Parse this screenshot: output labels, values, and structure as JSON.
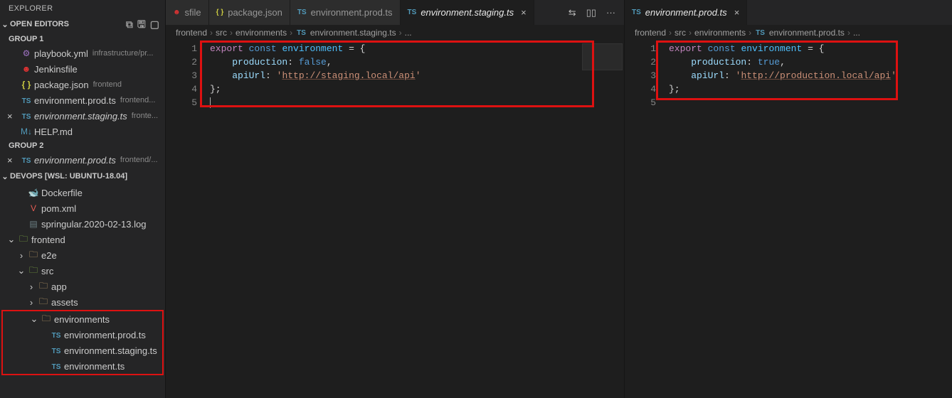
{
  "explorer": {
    "title": "EXPLORER",
    "openEditorsLabel": "OPEN EDITORS",
    "group1": "GROUP 1",
    "group2": "GROUP 2",
    "workspaceLabel": "DEVOPS [WSL: UBUNTU-18.04]",
    "openGroup1": [
      {
        "icon": "yml",
        "name": "playbook.yml",
        "dim": "infrastructure/pr..."
      },
      {
        "icon": "jenkins",
        "name": "Jenkinsfile",
        "dim": ""
      },
      {
        "icon": "json",
        "name": "package.json",
        "dim": "frontend"
      },
      {
        "icon": "ts",
        "name": "environment.prod.ts",
        "dim": "frontend..."
      },
      {
        "icon": "ts",
        "name": "environment.staging.ts",
        "dim": "fronte...",
        "close": true,
        "italic": true
      },
      {
        "icon": "md",
        "name": "HELP.md",
        "dim": ""
      }
    ],
    "openGroup2": [
      {
        "icon": "ts",
        "name": "environment.prod.ts",
        "dim": "frontend/...",
        "close": true,
        "italic": true
      }
    ],
    "tree": [
      {
        "indent": 1,
        "arrow": "",
        "icon": "docker",
        "label": "Dockerfile"
      },
      {
        "indent": 1,
        "arrow": "",
        "icon": "xml",
        "label": "pom.xml"
      },
      {
        "indent": 1,
        "arrow": "",
        "icon": "log",
        "label": "springular.2020-02-13.log"
      },
      {
        "indent": 0,
        "arrow": "v",
        "icon": "folder-g",
        "label": "frontend"
      },
      {
        "indent": 1,
        "arrow": ">",
        "icon": "folder",
        "label": "e2e"
      },
      {
        "indent": 1,
        "arrow": "v",
        "icon": "folder-g",
        "label": "src"
      },
      {
        "indent": 2,
        "arrow": ">",
        "icon": "folder",
        "label": "app"
      },
      {
        "indent": 2,
        "arrow": ">",
        "icon": "folder",
        "label": "assets"
      }
    ],
    "envFolder": {
      "indent": 2,
      "arrow": "v",
      "icon": "folder",
      "label": "environments"
    },
    "envFiles": [
      {
        "indent": 3,
        "icon": "ts",
        "label": "environment.prod.ts"
      },
      {
        "indent": 3,
        "icon": "ts",
        "label": "environment.staging.ts"
      },
      {
        "indent": 3,
        "icon": "ts",
        "label": "environment.ts"
      }
    ]
  },
  "editorLeft": {
    "tabs": [
      {
        "icon": "jenkins",
        "label": "sfile",
        "active": false
      },
      {
        "icon": "json",
        "label": "package.json",
        "active": false
      },
      {
        "icon": "ts",
        "label": "environment.prod.ts",
        "active": false
      },
      {
        "icon": "ts",
        "label": "environment.staging.ts",
        "active": true,
        "close": true
      }
    ],
    "breadcrumb": [
      "frontend",
      "src",
      "environments",
      "environment.staging.ts",
      "..."
    ],
    "code": {
      "l1a": "export",
      "l1b": "const",
      "l1c": "environment",
      "l1d": " = {",
      "l2a": "production",
      "l2b": ": ",
      "l2c": "false",
      "l2d": ",",
      "l3a": "apiUrl",
      "l3b": ": ",
      "l3c": "'",
      "l3u": "http://staging.local/api",
      "l3d": "'",
      "l4": "};"
    }
  },
  "editorRight": {
    "tabs": [
      {
        "icon": "ts",
        "label": "environment.prod.ts",
        "active": true,
        "close": true
      }
    ],
    "breadcrumb": [
      "frontend",
      "src",
      "environments",
      "environment.prod.ts",
      "..."
    ],
    "code": {
      "l1a": "export",
      "l1b": "const",
      "l1c": "environment",
      "l1d": " = {",
      "l2a": "production",
      "l2b": ": ",
      "l2c": "true",
      "l2d": ",",
      "l3a": "apiUrl",
      "l3b": ": ",
      "l3c": "'",
      "l3u": "http://production.local/api",
      "l3d": "'",
      "l4": "};"
    }
  },
  "icons": {
    "compare": "⇆",
    "split": "▯▯",
    "more": "···",
    "new": "⧉",
    "save": "🖫",
    "layout": "▢"
  }
}
